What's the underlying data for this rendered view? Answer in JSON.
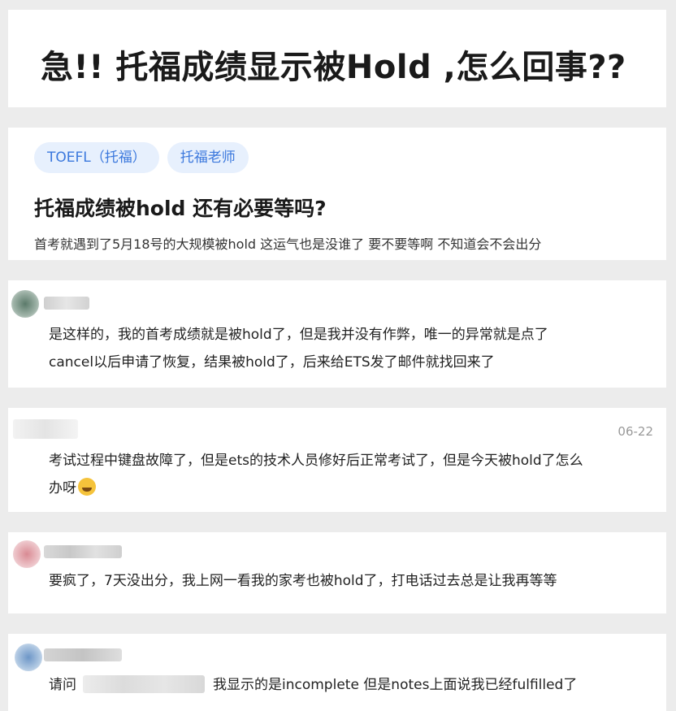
{
  "title": "急!! 托福成绩显示被Hold ,怎么回事??",
  "question": {
    "tags": [
      "TOEFL（托福）",
      "托福老师"
    ],
    "heading": "托福成绩被hold 还有必要等吗?",
    "description": "首考就遇到了5月18号的大规模被hold 这运气也是没谁了 要不要等啊 不知道会不会出分"
  },
  "comments": [
    {
      "line1": "是这样的，我的首考成绩就是被hold了，但是我并没有作弊，唯一的异常就是点了",
      "line2": "cancel以后申请了恢复，结果被hold了，后来给ETS发了邮件就找回来了"
    },
    {
      "date": "06-22",
      "line1": "考试过程中键盘故障了，但是ets的技术人员修好后正常考试了，但是今天被hold了怎么",
      "line2": "办呀",
      "emoji": "crying-face"
    },
    {
      "line1": "要疯了，7天没出分，我上网一看我的家考也被hold了，打电话过去总是让我再等等"
    },
    {
      "prefix": "请问",
      "suffix": "我显示的是incomplete 但是notes上面说我已经fulfilled了"
    }
  ],
  "colors": {
    "tag_bg": "#e7f0fd",
    "tag_text": "#3b78dd",
    "date": "#999999",
    "page_bg": "#ececec"
  }
}
